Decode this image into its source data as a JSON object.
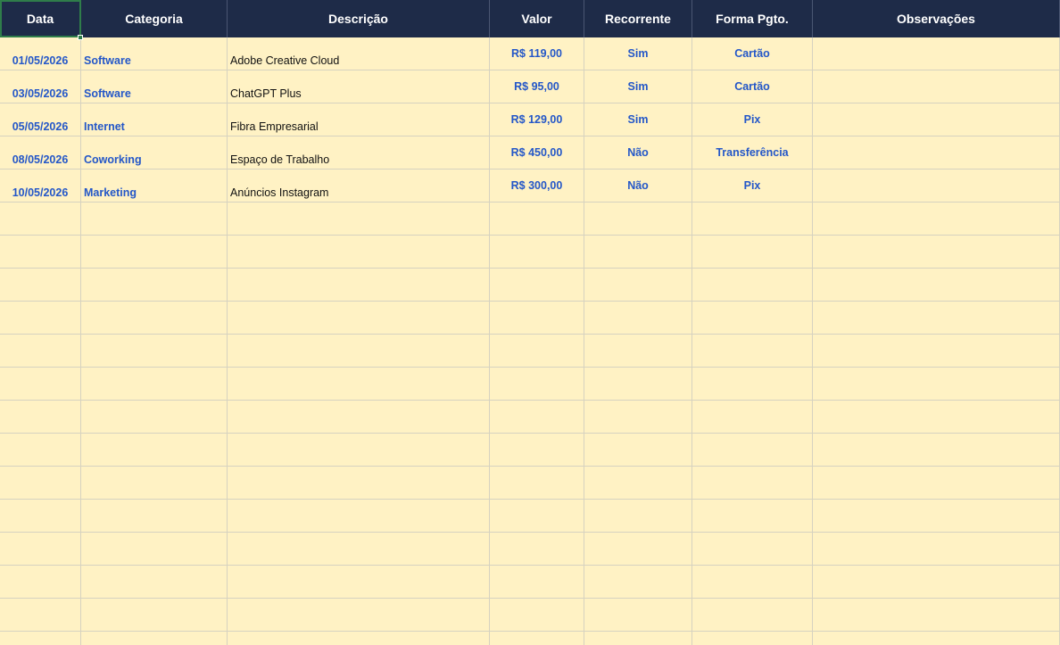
{
  "headers": [
    "Data",
    "Categoria",
    "Descrição",
    "Valor",
    "Recorrente",
    "Forma Pgto.",
    "Observações"
  ],
  "rows": [
    {
      "data": "01/05/2026",
      "categoria": "Software",
      "descricao": "Adobe Creative Cloud",
      "valor": "R$ 119,00",
      "recorrente": "Sim",
      "forma": "Cartão",
      "obs": ""
    },
    {
      "data": "03/05/2026",
      "categoria": "Software",
      "descricao": "ChatGPT Plus",
      "valor": "R$ 95,00",
      "recorrente": "Sim",
      "forma": "Cartão",
      "obs": ""
    },
    {
      "data": "05/05/2026",
      "categoria": "Internet",
      "descricao": "Fibra Empresarial",
      "valor": "R$ 129,00",
      "recorrente": "Sim",
      "forma": "Pix",
      "obs": ""
    },
    {
      "data": "08/05/2026",
      "categoria": "Coworking",
      "descricao": "Espaço de Trabalho",
      "valor": "R$ 450,00",
      "recorrente": "Não",
      "forma": "Transferência",
      "obs": ""
    },
    {
      "data": "10/05/2026",
      "categoria": "Marketing",
      "descricao": "Anúncios Instagram",
      "valor": "R$ 300,00",
      "recorrente": "Não",
      "forma": "Pix",
      "obs": ""
    }
  ],
  "colors": {
    "header_bg": "#1e2b48",
    "sheet_bg": "#fff2c4",
    "accent_text": "#2457c8",
    "selection": "#2f7d4a"
  }
}
